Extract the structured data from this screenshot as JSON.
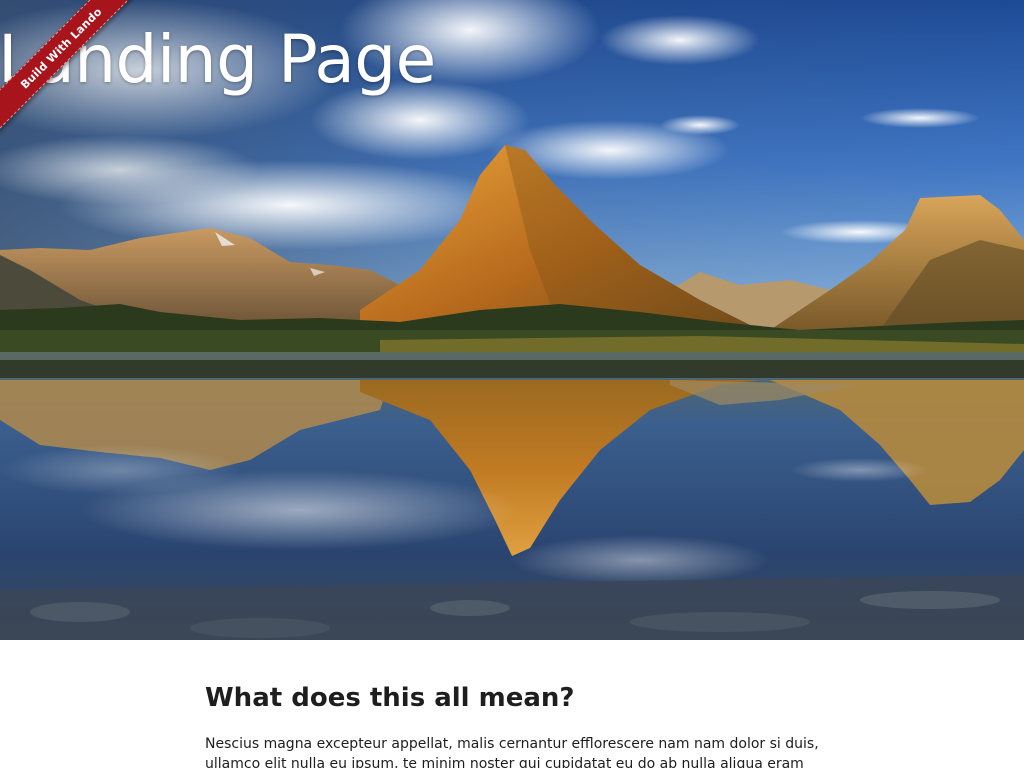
{
  "ribbon": {
    "label": "Build With Lando",
    "color": "#a8141c"
  },
  "hero": {
    "title": "Landing Page",
    "image_subject": "mountain-lake-reflection"
  },
  "content": {
    "heading": "What does this all mean?",
    "paragraph": "Nescius magna excepteur appellat, malis cernantur efflorescere nam nam dolor si duis, ullamco elit nulla eu ipsum, te minim noster qui cupidatat eu do ab nulla aliqua eram"
  }
}
